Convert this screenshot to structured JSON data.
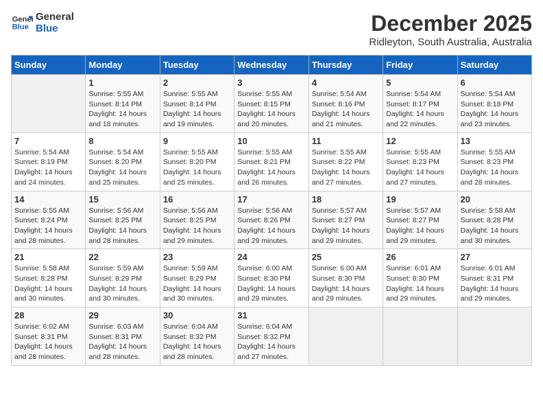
{
  "logo": {
    "line1": "General",
    "line2": "Blue"
  },
  "title": "December 2025",
  "subtitle": "Ridleyton, South Australia, Australia",
  "days_of_week": [
    "Sunday",
    "Monday",
    "Tuesday",
    "Wednesday",
    "Thursday",
    "Friday",
    "Saturday"
  ],
  "weeks": [
    [
      {
        "day": "",
        "info": ""
      },
      {
        "day": "1",
        "info": "Sunrise: 5:55 AM\nSunset: 8:14 PM\nDaylight: 14 hours\nand 18 minutes."
      },
      {
        "day": "2",
        "info": "Sunrise: 5:55 AM\nSunset: 8:14 PM\nDaylight: 14 hours\nand 19 minutes."
      },
      {
        "day": "3",
        "info": "Sunrise: 5:55 AM\nSunset: 8:15 PM\nDaylight: 14 hours\nand 20 minutes."
      },
      {
        "day": "4",
        "info": "Sunrise: 5:54 AM\nSunset: 8:16 PM\nDaylight: 14 hours\nand 21 minutes."
      },
      {
        "day": "5",
        "info": "Sunrise: 5:54 AM\nSunset: 8:17 PM\nDaylight: 14 hours\nand 22 minutes."
      },
      {
        "day": "6",
        "info": "Sunrise: 5:54 AM\nSunset: 8:18 PM\nDaylight: 14 hours\nand 23 minutes."
      }
    ],
    [
      {
        "day": "7",
        "info": "Sunrise: 5:54 AM\nSunset: 8:19 PM\nDaylight: 14 hours\nand 24 minutes."
      },
      {
        "day": "8",
        "info": "Sunrise: 5:54 AM\nSunset: 8:20 PM\nDaylight: 14 hours\nand 25 minutes."
      },
      {
        "day": "9",
        "info": "Sunrise: 5:55 AM\nSunset: 8:20 PM\nDaylight: 14 hours\nand 25 minutes."
      },
      {
        "day": "10",
        "info": "Sunrise: 5:55 AM\nSunset: 8:21 PM\nDaylight: 14 hours\nand 26 minutes."
      },
      {
        "day": "11",
        "info": "Sunrise: 5:55 AM\nSunset: 8:22 PM\nDaylight: 14 hours\nand 27 minutes."
      },
      {
        "day": "12",
        "info": "Sunrise: 5:55 AM\nSunset: 8:23 PM\nDaylight: 14 hours\nand 27 minutes."
      },
      {
        "day": "13",
        "info": "Sunrise: 5:55 AM\nSunset: 8:23 PM\nDaylight: 14 hours\nand 28 minutes."
      }
    ],
    [
      {
        "day": "14",
        "info": "Sunrise: 5:55 AM\nSunset: 8:24 PM\nDaylight: 14 hours\nand 28 minutes."
      },
      {
        "day": "15",
        "info": "Sunrise: 5:56 AM\nSunset: 8:25 PM\nDaylight: 14 hours\nand 28 minutes."
      },
      {
        "day": "16",
        "info": "Sunrise: 5:56 AM\nSunset: 8:25 PM\nDaylight: 14 hours\nand 29 minutes."
      },
      {
        "day": "17",
        "info": "Sunrise: 5:56 AM\nSunset: 8:26 PM\nDaylight: 14 hours\nand 29 minutes."
      },
      {
        "day": "18",
        "info": "Sunrise: 5:57 AM\nSunset: 8:27 PM\nDaylight: 14 hours\nand 29 minutes."
      },
      {
        "day": "19",
        "info": "Sunrise: 5:57 AM\nSunset: 8:27 PM\nDaylight: 14 hours\nand 29 minutes."
      },
      {
        "day": "20",
        "info": "Sunrise: 5:58 AM\nSunset: 8:28 PM\nDaylight: 14 hours\nand 30 minutes."
      }
    ],
    [
      {
        "day": "21",
        "info": "Sunrise: 5:58 AM\nSunset: 8:28 PM\nDaylight: 14 hours\nand 30 minutes."
      },
      {
        "day": "22",
        "info": "Sunrise: 5:59 AM\nSunset: 8:29 PM\nDaylight: 14 hours\nand 30 minutes."
      },
      {
        "day": "23",
        "info": "Sunrise: 5:59 AM\nSunset: 8:29 PM\nDaylight: 14 hours\nand 30 minutes."
      },
      {
        "day": "24",
        "info": "Sunrise: 6:00 AM\nSunset: 8:30 PM\nDaylight: 14 hours\nand 29 minutes."
      },
      {
        "day": "25",
        "info": "Sunrise: 6:00 AM\nSunset: 8:30 PM\nDaylight: 14 hours\nand 29 minutes."
      },
      {
        "day": "26",
        "info": "Sunrise: 6:01 AM\nSunset: 8:30 PM\nDaylight: 14 hours\nand 29 minutes."
      },
      {
        "day": "27",
        "info": "Sunrise: 6:01 AM\nSunset: 8:31 PM\nDaylight: 14 hours\nand 29 minutes."
      }
    ],
    [
      {
        "day": "28",
        "info": "Sunrise: 6:02 AM\nSunset: 8:31 PM\nDaylight: 14 hours\nand 28 minutes."
      },
      {
        "day": "29",
        "info": "Sunrise: 6:03 AM\nSunset: 8:31 PM\nDaylight: 14 hours\nand 28 minutes."
      },
      {
        "day": "30",
        "info": "Sunrise: 6:04 AM\nSunset: 8:32 PM\nDaylight: 14 hours\nand 28 minutes."
      },
      {
        "day": "31",
        "info": "Sunrise: 6:04 AM\nSunset: 8:32 PM\nDaylight: 14 hours\nand 27 minutes."
      },
      {
        "day": "",
        "info": ""
      },
      {
        "day": "",
        "info": ""
      },
      {
        "day": "",
        "info": ""
      }
    ]
  ]
}
